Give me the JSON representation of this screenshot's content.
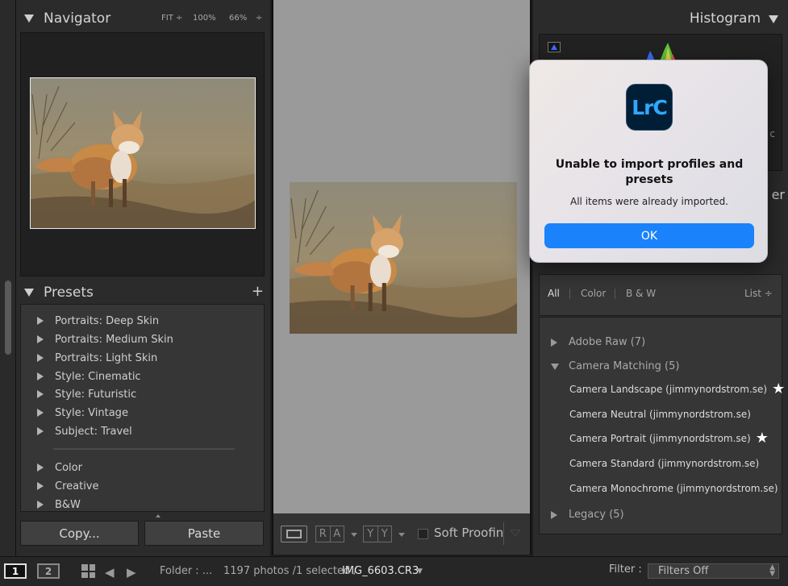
{
  "navigator": {
    "title": "Navigator",
    "zoom_fit": "FIT ÷",
    "zoom_100": "100%",
    "zoom_66": "66%",
    "zoom_more": "÷"
  },
  "presets": {
    "title": "Presets",
    "add": "+",
    "items": [
      "Portraits: Deep Skin",
      "Portraits: Medium Skin",
      "Portraits: Light Skin",
      "Style: Cinematic",
      "Style: Futuristic",
      "Style: Vintage",
      "Subject: Travel"
    ],
    "groups": [
      "Color",
      "Creative",
      "B&W"
    ]
  },
  "buttons": {
    "copy": "Copy...",
    "paste": "Paste"
  },
  "toolbar": {
    "ra_1": "R",
    "ra_2": "A",
    "yy_1": "Y",
    "yy_2": "Y",
    "soft_proofing": "Soft Proofing"
  },
  "histogram": {
    "title": "Histogram",
    "side_c": "c",
    "side_er": "er"
  },
  "profile_filter": {
    "all": "All",
    "color": "Color",
    "bw": "B & W",
    "list": "List ÷"
  },
  "profiles": {
    "adobe_raw": "Adobe Raw (7)",
    "camera_matching": "Camera Matching (5)",
    "items": [
      {
        "label": "Camera Landscape (jimmynordstrom.se)",
        "favorite": true
      },
      {
        "label": "Camera Neutral (jimmynordstrom.se)",
        "favorite": false
      },
      {
        "label": "Camera Portrait (jimmynordstrom.se)",
        "favorite": true
      },
      {
        "label": "Camera Standard (jimmynordstrom.se)",
        "favorite": false
      },
      {
        "label": "Camera Monochrome (jimmynordstrom.se)",
        "favorite": false
      }
    ],
    "legacy": "Legacy (5)"
  },
  "filmstrip": {
    "page1": "1",
    "page2": "2",
    "folder": "Folder : ...",
    "count": "1197 photos /1 selected /",
    "filename": "IMG_6603.CR3",
    "filter_label": "Filter :",
    "filter_value": "Filters Off"
  },
  "dialog": {
    "app_icon_text": "LrC",
    "title": "Unable to import profiles and presets",
    "message": "All items were already imported.",
    "ok": "OK"
  },
  "colors": {
    "accent_blue": "#1a82fb",
    "lrc_icon_bg": "#001e36",
    "lrc_icon_text": "#31a8ff"
  }
}
